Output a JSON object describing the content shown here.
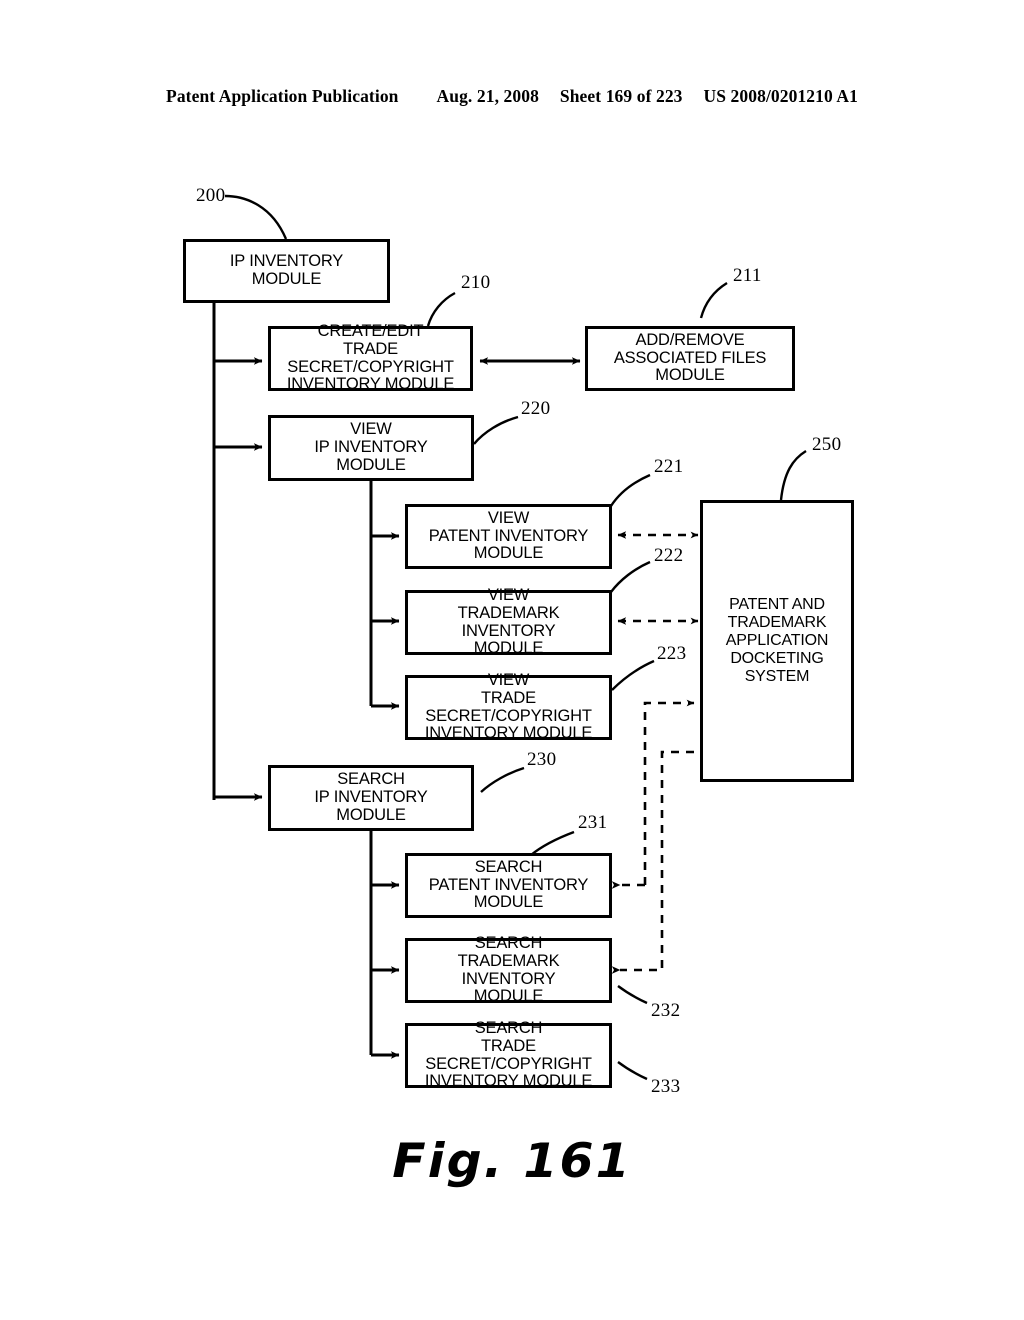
{
  "header": {
    "publication": "Patent Application Publication",
    "date": "Aug. 21, 2008",
    "sheet": "Sheet 169 of 223",
    "docnum": "US 2008/0201210 A1"
  },
  "figure": {
    "caption": "Fig. 161"
  },
  "nodes": [
    {
      "id": "200",
      "label": "IP INVENTORY\nMODULE"
    },
    {
      "id": "210",
      "label": "CREATE/EDIT\nTRADE SECRET/COPYRIGHT\nINVENTORY MODULE"
    },
    {
      "id": "211",
      "label": "ADD/REMOVE\nASSOCIATED FILES\nMODULE"
    },
    {
      "id": "220",
      "label": "VIEW\nIP INVENTORY\nMODULE"
    },
    {
      "id": "221",
      "label": "VIEW\nPATENT INVENTORY\nMODULE"
    },
    {
      "id": "222",
      "label": "VIEW\nTRADEMARK INVENTORY\nMODULE"
    },
    {
      "id": "223",
      "label": "VIEW\nTRADE SECRET/COPYRIGHT\nINVENTORY MODULE"
    },
    {
      "id": "230",
      "label": "SEARCH\nIP INVENTORY\nMODULE"
    },
    {
      "id": "231",
      "label": "SEARCH\nPATENT INVENTORY\nMODULE"
    },
    {
      "id": "232",
      "label": "SEARCH\nTRADEMARK INVENTORY\nMODULE"
    },
    {
      "id": "233",
      "label": "SEARCH\nTRADE SECRET/COPYRIGHT\nINVENTORY MODULE"
    },
    {
      "id": "250",
      "label": "PATENT AND\nTRADEMARK\nAPPLICATION\nDOCKETING\nSYSTEM"
    }
  ],
  "refs": {
    "r200": "200",
    "r210": "210",
    "r211": "211",
    "r220": "220",
    "r221": "221",
    "r222": "222",
    "r223": "223",
    "r230": "230",
    "r231": "231",
    "r232": "232",
    "r233": "233",
    "r250": "250"
  },
  "colors": {
    "ink": "#000000",
    "paper": "#ffffff"
  }
}
